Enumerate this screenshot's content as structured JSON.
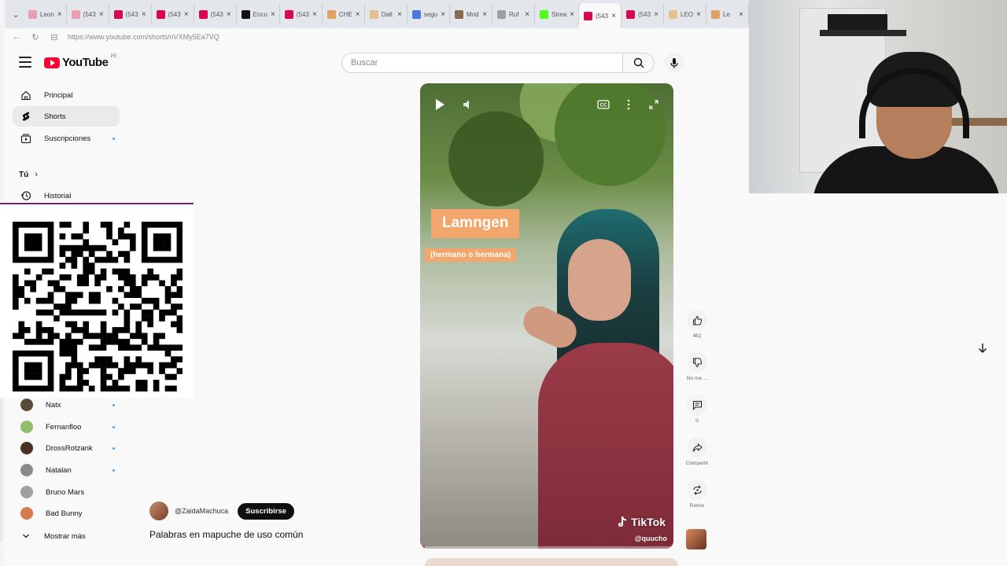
{
  "browser": {
    "tabs": [
      {
        "label": "Leon",
        "color": "#e8a0b0",
        "active": false
      },
      {
        "label": "(543",
        "color": "#e8a0b0",
        "active": false
      },
      {
        "label": "(543",
        "color": "#d6084e",
        "active": false
      },
      {
        "label": "(543",
        "color": "#d6084e",
        "active": false
      },
      {
        "label": "(543",
        "color": "#d6084e",
        "active": false
      },
      {
        "label": "Encu",
        "color": "#111111",
        "active": false
      },
      {
        "label": "(543",
        "color": "#d6084e",
        "active": false
      },
      {
        "label": "CHE",
        "color": "#e0a060",
        "active": false
      },
      {
        "label": "Dalt",
        "color": "#e0c090",
        "active": false
      },
      {
        "label": "segu",
        "color": "#4a7adf",
        "active": false
      },
      {
        "label": "Mod",
        "color": "#8a6a4a",
        "active": false
      },
      {
        "label": "Ruf",
        "color": "#9aa0a8",
        "active": false
      },
      {
        "label": "Strea",
        "color": "#53fc18",
        "active": false
      },
      {
        "label": "(543",
        "color": "#d6084e",
        "active": true
      },
      {
        "label": "(543",
        "color": "#d6084e",
        "active": false
      },
      {
        "label": "LEO",
        "color": "#e8c090",
        "active": false
      },
      {
        "label": "Le",
        "color": "#e0a060",
        "active": false
      }
    ],
    "url": "https://www.youtube.com/shorts/nVXMy5Ea7VQ"
  },
  "header": {
    "logo_text": "YouTube",
    "region": "PE",
    "search_placeholder": "Buscar"
  },
  "sidebar": {
    "items": [
      {
        "label": "Principal",
        "icon": "home-icon"
      },
      {
        "label": "Shorts",
        "icon": "shorts-icon"
      },
      {
        "label": "Suscripciones",
        "icon": "subscriptions-icon"
      }
    ],
    "you_section": "Tú",
    "history": "Historial",
    "channels": [
      {
        "name": "Natx",
        "color": "#5a4a3a"
      },
      {
        "name": "Fernanfloo",
        "color": "#8fbf6a"
      },
      {
        "name": "DrossRotzank",
        "color": "#4a3020"
      },
      {
        "name": "Natalan",
        "color": "#8a8a8a"
      },
      {
        "name": "Bruno Mars",
        "color": "#a0a0a0"
      },
      {
        "name": "Bad Bunny",
        "color": "#d67a4a"
      }
    ],
    "show_more": "Mostrar más"
  },
  "short": {
    "overlay_title": "Lamngen",
    "overlay_subtitle": "(hermano o hermana)",
    "watermark": "TikTok",
    "handle": "@quucho",
    "progress": 0.02
  },
  "channel": {
    "name": "@ZaidaMachuca",
    "subscribe": "Suscribirse"
  },
  "video_title": "Palabras en mapuche de uso común",
  "actions": {
    "likes": "482",
    "dislike_label": "No me ...",
    "comments": "0",
    "share_label": "Compartir",
    "remix_label": "Remix"
  }
}
